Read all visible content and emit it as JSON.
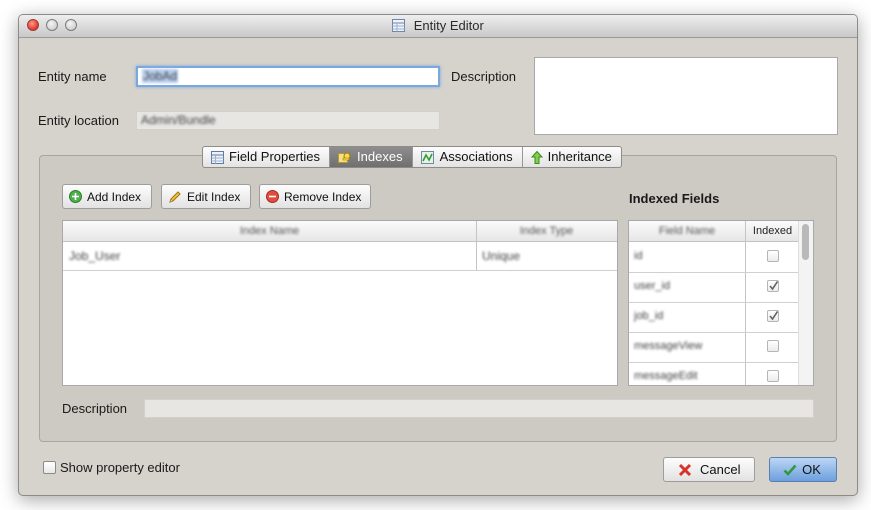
{
  "window": {
    "title": "Entity Editor"
  },
  "entity": {
    "name_label": "Entity name",
    "name_value": "JobAd",
    "location_label": "Entity location",
    "location_value": "Admin/Bundle",
    "description_label": "Description",
    "description_value": ""
  },
  "tabs": [
    {
      "label": "Field Properties",
      "icon": "table-icon",
      "active": false
    },
    {
      "label": "Indexes",
      "icon": "key-icon",
      "active": true
    },
    {
      "label": "Associations",
      "icon": "associations-icon",
      "active": false
    },
    {
      "label": "Inheritance",
      "icon": "up-arrow-icon",
      "active": false
    }
  ],
  "toolbar": {
    "add_index": "Add Index",
    "edit_index": "Edit Index",
    "remove_index": "Remove Index"
  },
  "index_table": {
    "columns": [
      "Index Name",
      "Index Type"
    ],
    "rows": [
      {
        "name": "Job_User",
        "type": "Unique"
      }
    ]
  },
  "indexed_fields": {
    "title": "Indexed Fields",
    "columns": [
      "Field Name",
      "Indexed"
    ],
    "rows": [
      {
        "name": "id",
        "indexed": false
      },
      {
        "name": "user_id",
        "indexed": true
      },
      {
        "name": "job_id",
        "indexed": true
      },
      {
        "name": "messageView",
        "indexed": false
      },
      {
        "name": "messageEdit",
        "indexed": false
      }
    ]
  },
  "bottom": {
    "description_label": "Description",
    "description_value": "",
    "show_property_editor": "Show property editor",
    "show_property_editor_checked": false,
    "cancel": "Cancel",
    "ok": "OK"
  },
  "colors": {
    "accent": "#6d9fde",
    "window_bg": "#d6d2cc",
    "ok_button": "#7aa7e0",
    "cancel_icon": "#d8332a"
  }
}
